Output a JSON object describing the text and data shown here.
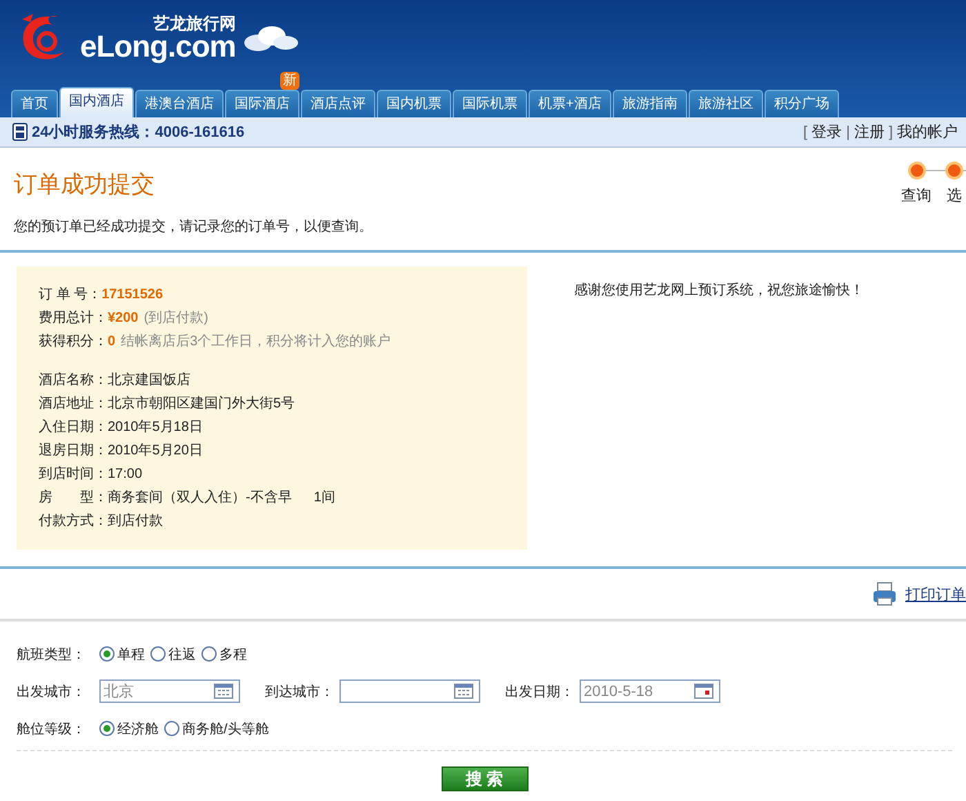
{
  "header": {
    "logo_cn": "艺龙旅行网",
    "logo_en": "eLong.com"
  },
  "tabs": [
    {
      "label": "首页",
      "selected": false
    },
    {
      "label": "国内酒店",
      "selected": true
    },
    {
      "label": "港澳台酒店",
      "selected": false
    },
    {
      "label": "国际酒店",
      "selected": false,
      "badge": "新"
    },
    {
      "label": "酒店点评",
      "selected": false
    },
    {
      "label": "国内机票",
      "selected": false
    },
    {
      "label": "国际机票",
      "selected": false
    },
    {
      "label": "机票+酒店",
      "selected": false
    },
    {
      "label": "旅游指南",
      "selected": false
    },
    {
      "label": "旅游社区",
      "selected": false
    },
    {
      "label": "积分广场",
      "selected": false
    }
  ],
  "service_bar": {
    "hotline": "24小时服务热线：4006-161616",
    "links": [
      {
        "kind": "text",
        "text": "["
      },
      {
        "kind": "link",
        "text": "登录"
      },
      {
        "kind": "text",
        "text": "|"
      },
      {
        "kind": "link",
        "text": "注册"
      },
      {
        "kind": "text",
        "text": "]"
      },
      {
        "kind": "link",
        "text": "我的帐户"
      }
    ]
  },
  "page": {
    "title": "订单成功提交",
    "subtitle": "您的预订单已经成功提交，请记录您的订单号，以便查询。"
  },
  "steps": [
    {
      "label": "查询",
      "active": true
    },
    {
      "label": "选",
      "active": true
    }
  ],
  "order_summary": [
    {
      "label": "订 单 号：",
      "value": "17151526"
    },
    {
      "label": "费用总计：",
      "value": "¥200",
      "note": "(到店付款)"
    },
    {
      "label": "获得积分：",
      "value": "0",
      "note": "结帐离店后3个工作日，积分将计入您的账户"
    }
  ],
  "order_details": [
    {
      "label": "酒店名称：",
      "value": "北京建国饭店"
    },
    {
      "label": "酒店地址：",
      "value": "北京市朝阳区建国门外大街5号"
    },
    {
      "label": "入住日期：",
      "value": "2010年5月18日"
    },
    {
      "label": "退房日期：",
      "value": "2010年5月20日"
    },
    {
      "label": "到店时间：",
      "value": "17:00"
    },
    {
      "label": "房　　型：",
      "value": "商务套间（双人入住）-不含早",
      "note": "1间"
    },
    {
      "label": "付款方式：",
      "value": "到店付款"
    }
  ],
  "thanks": "感谢您使用艺龙网上预订系统，祝您旅途愉快！",
  "print_link": "打印订单",
  "flight_search": {
    "trip_type": {
      "label": "航班类型：",
      "options": [
        {
          "label": "单程",
          "selected": true
        },
        {
          "label": "往返",
          "selected": false
        },
        {
          "label": "多程",
          "selected": false
        }
      ]
    },
    "fields": [
      {
        "label": "出发城市：",
        "value": "北京",
        "kind": "city"
      },
      {
        "label": "到达城市：",
        "kind": "city"
      },
      {
        "label": "出发日期：",
        "value": "2010-5-18",
        "kind": "date"
      }
    ],
    "cabin": {
      "label": "舱位等级：",
      "options": [
        {
          "label": "经济舱",
          "selected": true
        },
        {
          "label": "商务舱/头等舱",
          "selected": false
        }
      ]
    },
    "search_button": "搜 索"
  }
}
